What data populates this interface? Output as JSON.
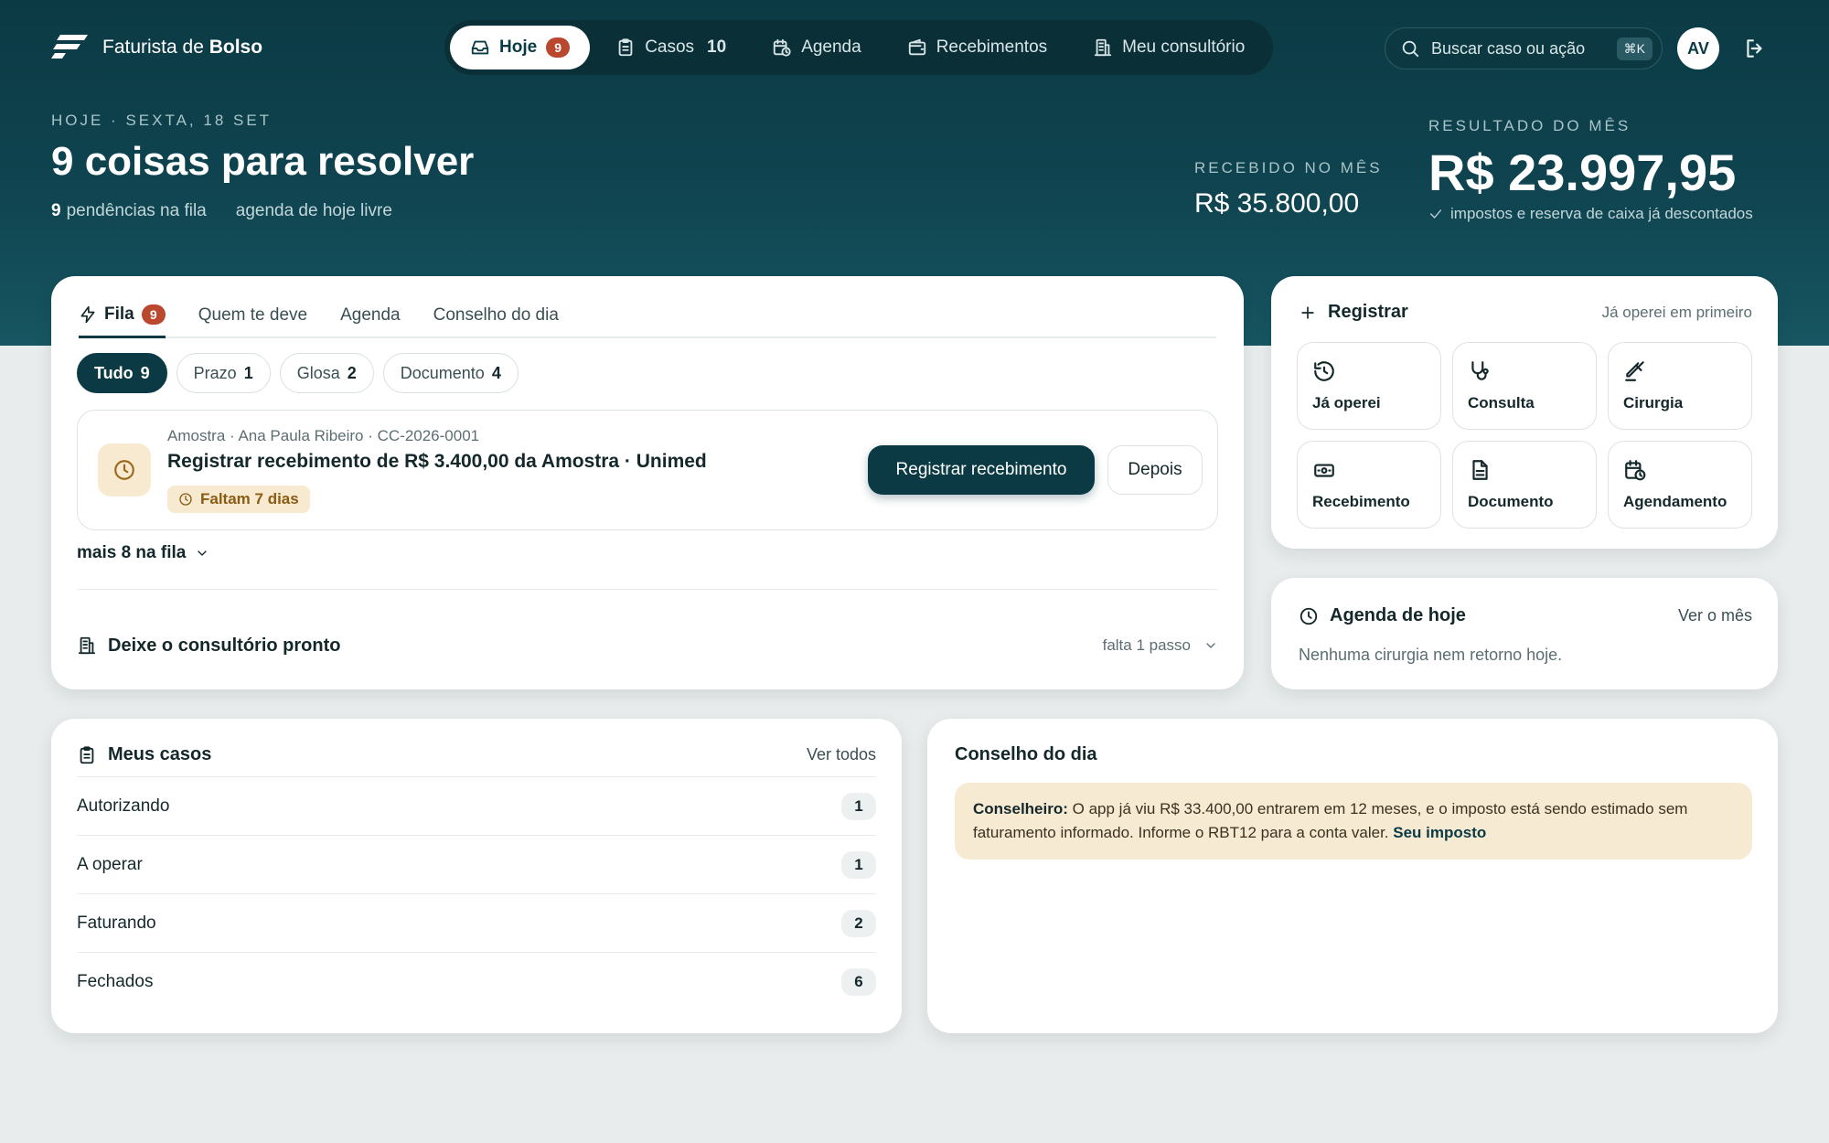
{
  "brand": {
    "name_prefix": "Faturista de",
    "name_bold": "Bolso"
  },
  "nav": [
    {
      "label": "Hoje",
      "badge": "9",
      "icon": "inbox-icon",
      "active": true
    },
    {
      "label": "Casos",
      "count": "10",
      "icon": "clipboard-icon"
    },
    {
      "label": "Agenda",
      "icon": "calendar-clock-icon"
    },
    {
      "label": "Recebimentos",
      "icon": "wallet-icon"
    },
    {
      "label": "Meu consultório",
      "icon": "building-icon"
    }
  ],
  "search": {
    "placeholder": "Buscar caso ou ação",
    "shortcut": "⌘K"
  },
  "user": {
    "initials": "AV"
  },
  "hero": {
    "date_label": "HOJE · SEXTA, 18 SET",
    "title": "9 coisas para resolver",
    "pending_count": "9",
    "pending_text": "pendências na fila",
    "agenda_text": "agenda de hoje livre",
    "received_label": "RECEBIDO NO MÊS",
    "received_value": "R$ 35.800,00",
    "result_label": "RESULTADO DO MÊS",
    "result_value": "R$ 23.997,95",
    "result_note": "impostos e reserva de caixa já descontados"
  },
  "queue": {
    "tabs": [
      {
        "label": "Fila",
        "badge": "9",
        "active": true
      },
      {
        "label": "Quem te deve"
      },
      {
        "label": "Agenda"
      },
      {
        "label": "Conselho do dia"
      }
    ],
    "filters": [
      {
        "label": "Tudo",
        "count": "9",
        "active": true
      },
      {
        "label": "Prazo",
        "count": "1"
      },
      {
        "label": "Glosa",
        "count": "2"
      },
      {
        "label": "Documento",
        "count": "4"
      }
    ],
    "item": {
      "meta": "Amostra · Ana Paula Ribeiro · CC-2026-0001",
      "title": "Registrar recebimento de R$ 3.400,00 da Amostra · Unimed",
      "tag": "Faltam 7 dias",
      "primary_action": "Registrar recebimento",
      "secondary_action": "Depois"
    },
    "more_label": "mais 8 na fila",
    "setup_title": "Deixe o consultório pronto",
    "setup_status": "falta 1 passo"
  },
  "register": {
    "title": "Registrar",
    "hint": "Já operei em primeiro",
    "tiles": [
      {
        "label": "Já operei",
        "icon": "history-icon"
      },
      {
        "label": "Consulta",
        "icon": "stethoscope-icon"
      },
      {
        "label": "Cirurgia",
        "icon": "scalpel-icon"
      },
      {
        "label": "Recebimento",
        "icon": "banknote-icon"
      },
      {
        "label": "Documento",
        "icon": "document-icon"
      },
      {
        "label": "Agendamento",
        "icon": "calendar-clock-icon"
      }
    ]
  },
  "agenda": {
    "title": "Agenda de hoje",
    "link": "Ver o mês",
    "empty": "Nenhuma cirurgia nem retorno hoje."
  },
  "cases": {
    "title": "Meus casos",
    "link": "Ver todos",
    "rows": [
      {
        "label": "Autorizando",
        "count": "1"
      },
      {
        "label": "A operar",
        "count": "1"
      },
      {
        "label": "Faturando",
        "count": "2"
      },
      {
        "label": "Fechados",
        "count": "6"
      }
    ]
  },
  "advice": {
    "title": "Conselho do dia",
    "speaker": "Conselheiro:",
    "text": " O app já viu R$ 33.400,00 entrarem em 12 meses, e o imposto está sendo estimado sem faturamento informado. Informe o RBT12 para a conta valer. ",
    "link": "Seu imposto"
  },
  "colors": {
    "primary": "#0b3a44",
    "badge": "#b9482f",
    "warning_bg": "#f8ead0",
    "advice_bg": "#f7ead2"
  }
}
